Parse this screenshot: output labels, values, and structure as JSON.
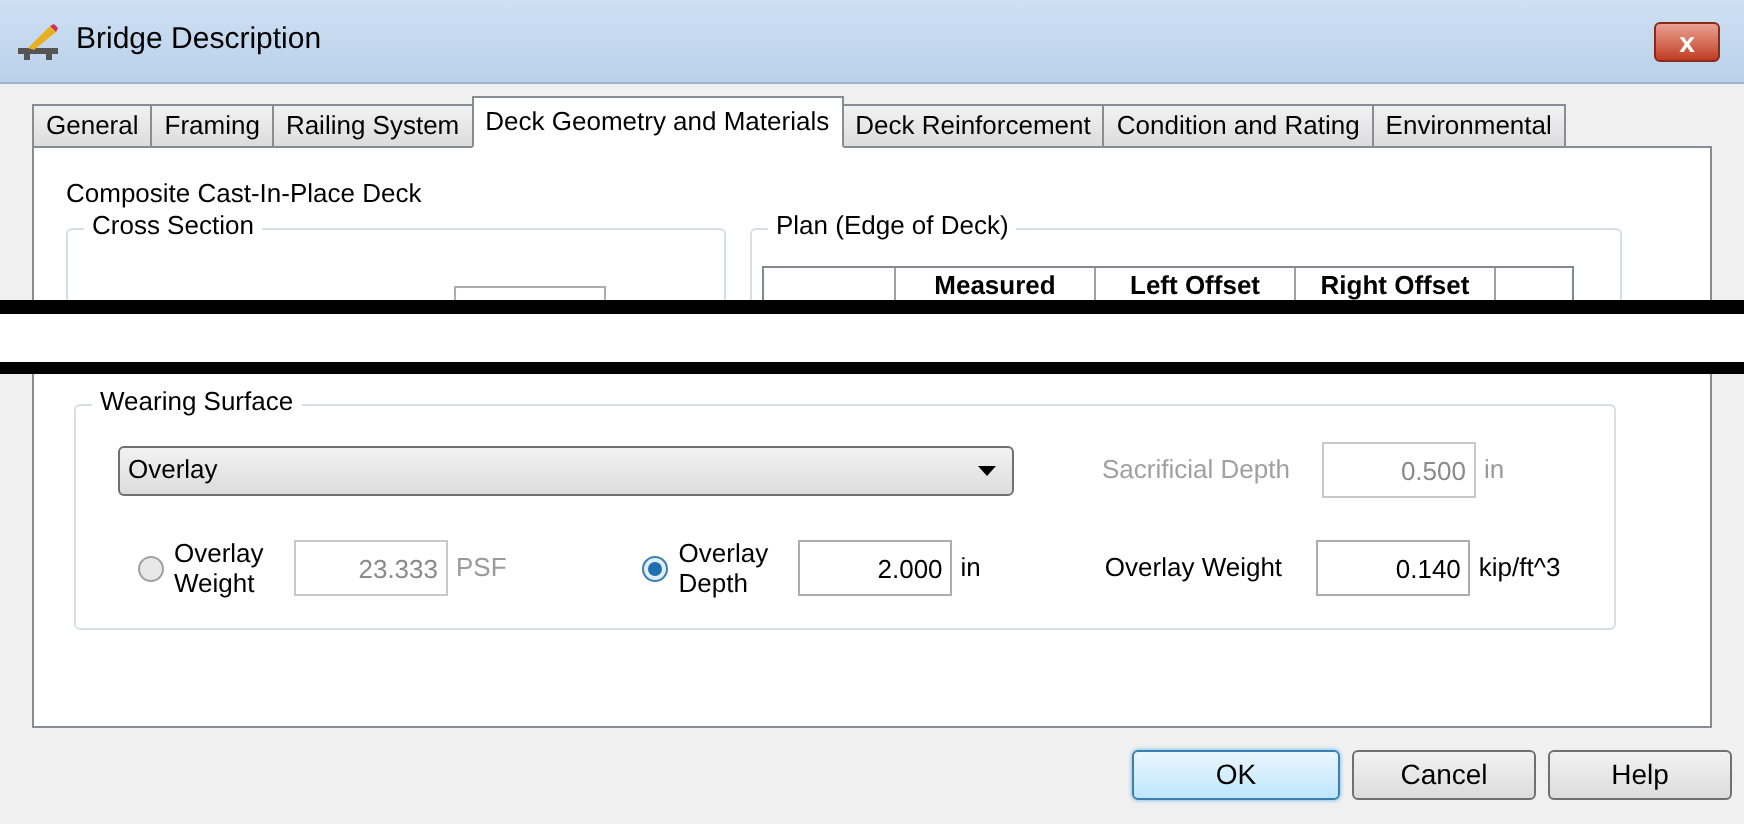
{
  "window": {
    "title": "Bridge Description",
    "close": "x"
  },
  "tabs": [
    {
      "label": "General",
      "selected": false
    },
    {
      "label": "Framing",
      "selected": false
    },
    {
      "label": "Railing System",
      "selected": false
    },
    {
      "label": "Deck Geometry and Materials",
      "selected": true
    },
    {
      "label": "Deck Reinforcement",
      "selected": false
    },
    {
      "label": "Condition and Rating",
      "selected": false
    },
    {
      "label": "Environmental",
      "selected": false
    }
  ],
  "deck_type": "Composite Cast-In-Place Deck",
  "cross_section": {
    "title": "Cross Section"
  },
  "plan": {
    "title": "Plan (Edge of Deck)",
    "columns": [
      "Measured",
      "Left Offset",
      "Right Offset"
    ]
  },
  "wearing_surface": {
    "title": "Wearing Surface",
    "type": "Overlay",
    "sacrificial_depth": {
      "label": "Sacrificial Depth",
      "value": "0.500",
      "unit": "in",
      "disabled": true
    },
    "options": [
      {
        "label": "Overlay Weight",
        "selected": false,
        "value": "23.333",
        "unit": "PSF",
        "disabled": true
      },
      {
        "label": "Overlay Depth",
        "selected": true,
        "value": "2.000",
        "unit": "in",
        "disabled": false
      }
    ],
    "overlay_weight": {
      "label": "Overlay Weight",
      "value": "0.140",
      "unit": "kip/ft^3",
      "disabled": false
    }
  },
  "buttons": [
    {
      "label": "OK",
      "default": true
    },
    {
      "label": "Cancel",
      "default": false
    },
    {
      "label": "Help",
      "default": false
    }
  ]
}
